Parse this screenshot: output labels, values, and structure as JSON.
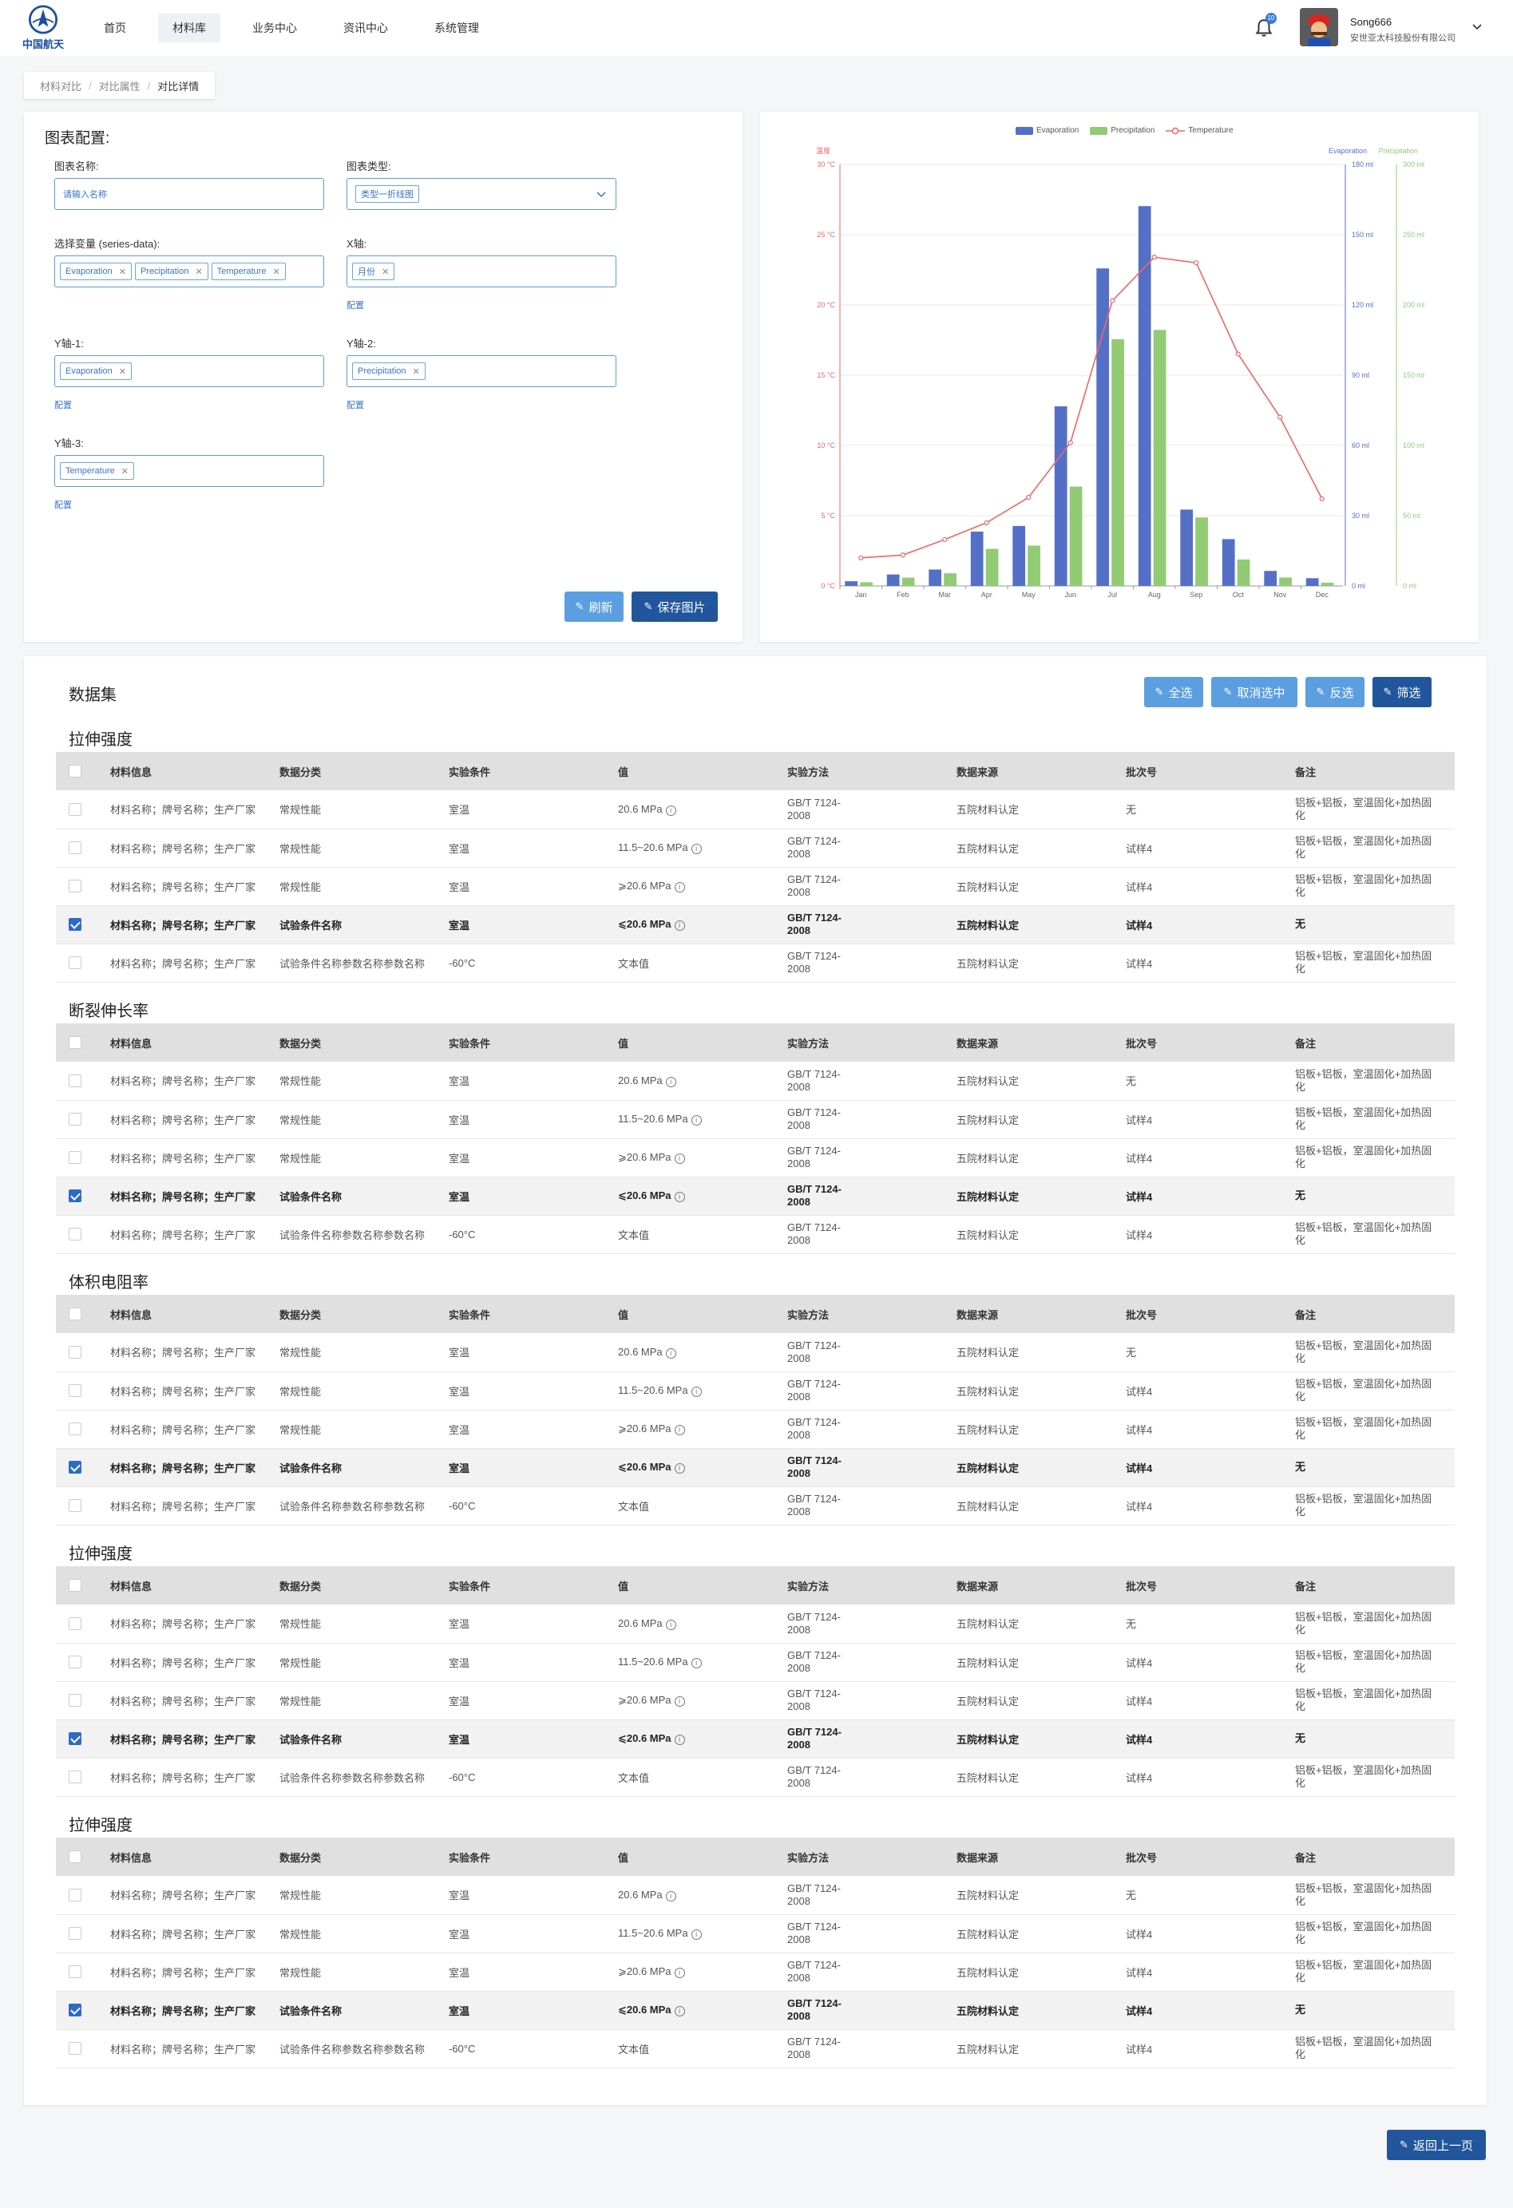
{
  "header": {
    "logo_text": "中国航天",
    "nav": [
      {
        "label": "首页",
        "active": false
      },
      {
        "label": "材料库",
        "active": true
      },
      {
        "label": "业务中心",
        "active": false
      },
      {
        "label": "资讯中心",
        "active": false
      },
      {
        "label": "系统管理",
        "active": false
      }
    ],
    "notification_count": "10",
    "user_name": "Song666",
    "user_org": "安世亚太科技股份有限公司"
  },
  "breadcrumb": [
    "材料对比",
    "对比属性",
    "对比详情"
  ],
  "config": {
    "title": "图表配置:",
    "chart_name_label": "图表名称:",
    "chart_name_placeholder": "请输入名称",
    "chart_type_label": "图表类型:",
    "chart_type_value": "类型一折线图",
    "variables_label": "选择变量 (series-data):",
    "variables": [
      "Evaporation",
      "Precipitation",
      "Temperature"
    ],
    "x_axis_label": "X轴:",
    "x_axis_value": "月份",
    "y1_label": "Y轴-1:",
    "y1_value": "Evaporation",
    "y2_label": "Y轴-2:",
    "y2_value": "Precipitation",
    "y3_label": "Y轴-3:",
    "y3_value": "Temperature",
    "config_link": "配置",
    "refresh_button": "刷新",
    "save_image_button": "保存图片"
  },
  "chart_data": {
    "type": "bar",
    "categories": [
      "Jan",
      "Feb",
      "Mar",
      "Apr",
      "May",
      "Jun",
      "Jul",
      "Aug",
      "Sep",
      "Oct",
      "Nov",
      "Dec"
    ],
    "series": [
      {
        "name": "Evaporation",
        "type": "bar",
        "axis": "left",
        "color": "#5470c6",
        "values": [
          2.0,
          4.9,
          7.0,
          23.2,
          25.6,
          76.7,
          135.6,
          162.2,
          32.6,
          20.0,
          6.4,
          3.3
        ]
      },
      {
        "name": "Precipitation",
        "type": "bar",
        "axis": "right",
        "color": "#91cc75",
        "values": [
          2.6,
          5.9,
          9.0,
          26.4,
          28.7,
          70.7,
          175.6,
          182.2,
          48.7,
          18.8,
          6.0,
          2.3
        ]
      },
      {
        "name": "Temperature",
        "type": "line",
        "axis": "temp",
        "color": "#ee6666",
        "values": [
          2.0,
          2.2,
          3.3,
          4.5,
          6.3,
          10.2,
          20.3,
          23.4,
          23.0,
          16.5,
          12.0,
          6.2
        ]
      }
    ],
    "axes": {
      "temp": {
        "name": "温度",
        "min": 0,
        "max": 30,
        "ticks": [
          "0 °C",
          "5 °C",
          "10 °C",
          "15 °C",
          "20 °C",
          "25 °C",
          "30 °C"
        ],
        "color": "#ee6666"
      },
      "left": {
        "name": "Evaporation",
        "min": 0,
        "max": 180,
        "ticks": [
          "0 ml",
          "30 ml",
          "60 ml",
          "90 ml",
          "120 ml",
          "150 ml",
          "180 ml"
        ],
        "color": "#5470c6"
      },
      "right": {
        "name": "Precipitation",
        "min": 0,
        "max": 300,
        "ticks": [
          "0 ml",
          "50 ml",
          "100 ml",
          "150 ml",
          "200 ml",
          "250 ml",
          "300 ml"
        ],
        "color": "#91cc75"
      }
    },
    "legend": [
      "Evaporation",
      "Precipitation",
      "Temperature"
    ],
    "legend_position": "top-center",
    "grid": true
  },
  "dataset": {
    "title": "数据集",
    "buttons": {
      "select_all": "全选",
      "deselect": "取消选中",
      "invert": "反选",
      "filter": "筛选"
    },
    "columns": [
      "材料信息",
      "数据分类",
      "实验条件",
      "值",
      "实验方法",
      "数据来源",
      "批次号",
      "备注"
    ],
    "rows": [
      {
        "info": "材料名称；牌号名称；生产厂家",
        "category": "常规性能",
        "condition": "室温",
        "value": "20.6 MPa",
        "info_icon": true,
        "method": "GB/T 7124-2008",
        "source": "五院材料认定",
        "batch": "无",
        "note": "铝板+铝板，室温固化+加热固化",
        "checked": false
      },
      {
        "info": "材料名称；牌号名称；生产厂家",
        "category": "常规性能",
        "condition": "室温",
        "value": "11.5~20.6 MPa",
        "info_icon": true,
        "method": "GB/T 7124-2008",
        "source": "五院材料认定",
        "batch": "试样4",
        "note": "铝板+铝板，室温固化+加热固化",
        "checked": false
      },
      {
        "info": "材料名称；牌号名称；生产厂家",
        "category": "常规性能",
        "condition": "室温",
        "value": "⩾20.6 MPa",
        "info_icon": true,
        "method": "GB/T 7124-2008",
        "source": "五院材料认定",
        "batch": "试样4",
        "note": "铝板+铝板，室温固化+加热固化",
        "checked": false
      },
      {
        "info": "材料名称；牌号名称；生产厂家",
        "category": "试验条件名称",
        "condition": "室温",
        "value": "⩽20.6 MPa",
        "info_icon": true,
        "method": "GB/T 7124-2008",
        "source": "五院材料认定",
        "batch": "试样4",
        "note": "无",
        "checked": true
      },
      {
        "info": "材料名称；牌号名称；生产厂家",
        "category": "试验条件名称参数名称参数名称",
        "condition": "-60°C",
        "value": "文本值",
        "info_icon": false,
        "method": "GB/T 7124-2008",
        "source": "五院材料认定",
        "batch": "试样4",
        "note": "铝板+铝板，室温固化+加热固化",
        "checked": false
      }
    ],
    "sections": [
      "拉伸强度",
      "断裂伸长率",
      "体积电阻率",
      "拉伸强度",
      "拉伸强度"
    ]
  },
  "footer": {
    "back_button": "返回上一页"
  }
}
